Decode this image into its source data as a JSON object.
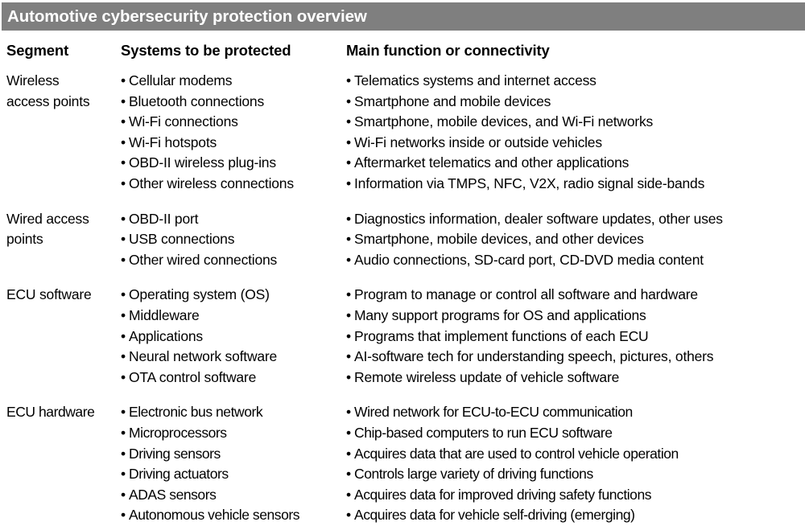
{
  "title": "Automotive cybersecurity protection overview",
  "colors": {
    "title_bar_background": "#7f7f7f",
    "title_text": "#ffffff",
    "body_text": "#000000",
    "page_background": "#ffffff"
  },
  "headers": {
    "segment": "Segment",
    "systems": "Systems to be protected",
    "function": "Main function or connectivity"
  },
  "bullet_glyph": "•",
  "sections": [
    {
      "segment_lines": [
        "Wireless",
        "access points"
      ],
      "rows": [
        {
          "system": "Cellular modems",
          "function": "Telematics systems and internet access"
        },
        {
          "system": "Bluetooth connections",
          "function": "Smartphone and mobile devices"
        },
        {
          "system": "Wi-Fi connections",
          "function": "Smartphone, mobile devices, and Wi-Fi networks"
        },
        {
          "system": "Wi-Fi hotspots",
          "function": "Wi-Fi networks inside or outside vehicles"
        },
        {
          "system": "OBD-II wireless plug-ins",
          "function": "Aftermarket telematics and other applications"
        },
        {
          "system": "Other wireless connections",
          "function": "Information via TMPS, NFC, V2X, radio signal side-bands"
        }
      ]
    },
    {
      "segment_lines": [
        "Wired access",
        "points"
      ],
      "rows": [
        {
          "system": "OBD-II port",
          "function": "Diagnostics information, dealer software updates, other uses"
        },
        {
          "system": "USB connections",
          "function": "Smartphone, mobile devices, and other devices"
        },
        {
          "system": "Other wired connections",
          "function": "Audio connections, SD-card port, CD-DVD media content"
        }
      ]
    },
    {
      "segment_lines": [
        "ECU software"
      ],
      "rows": [
        {
          "system": "Operating system (OS)",
          "function": "Program to manage or control all software and hardware"
        },
        {
          "system": "Middleware",
          "function": "Many support programs for OS and applications"
        },
        {
          "system": "Applications",
          "function": "Programs that implement functions of each ECU"
        },
        {
          "system": "Neural network software",
          "function": "AI-software tech for understanding speech, pictures, others"
        },
        {
          "system": "OTA control software",
          "function": "Remote wireless update of vehicle software"
        }
      ]
    },
    {
      "segment_lines": [
        "ECU hardware"
      ],
      "tight": true,
      "rows": [
        {
          "system": "Electronic bus network",
          "function": "Wired network for ECU-to-ECU communication"
        },
        {
          "system": "Microprocessors",
          "function": "Chip-based computers to run ECU software"
        },
        {
          "system": "Driving sensors",
          "function": "Acquires data that are used to control vehicle operation"
        },
        {
          "system": "Driving actuators",
          "function": "Controls large variety of driving functions"
        },
        {
          "system": "ADAS sensors",
          "function": "Acquires data for improved driving safety functions"
        },
        {
          "system": "Autonomous vehicle sensors",
          "function": "Acquires data for vehicle self-driving (emerging)"
        }
      ]
    }
  ]
}
